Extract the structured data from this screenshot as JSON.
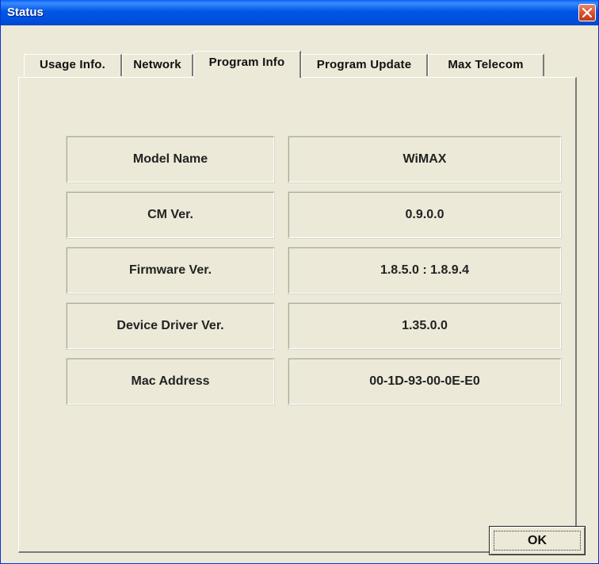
{
  "window": {
    "title": "Status"
  },
  "tabs": [
    {
      "label": "Usage Info.",
      "active": false
    },
    {
      "label": "Network",
      "active": false
    },
    {
      "label": "Program Info",
      "active": true
    },
    {
      "label": "Program Update",
      "active": false
    },
    {
      "label": "Max Telecom",
      "active": false
    }
  ],
  "program_info": {
    "rows": [
      {
        "label": "Model Name",
        "value": "WiMAX"
      },
      {
        "label": "CM Ver.",
        "value": "0.9.0.0"
      },
      {
        "label": "Firmware Ver.",
        "value": "1.8.5.0 : 1.8.9.4"
      },
      {
        "label": "Device Driver Ver.",
        "value": "1.35.0.0"
      },
      {
        "label": "Mac Address",
        "value": "00-1D-93-00-0E-E0"
      }
    ]
  },
  "buttons": {
    "ok_label": "OK"
  },
  "colors": {
    "titlebar": "#0055e5",
    "window_bg": "#ece9d8",
    "close_button": "#d8532c"
  }
}
